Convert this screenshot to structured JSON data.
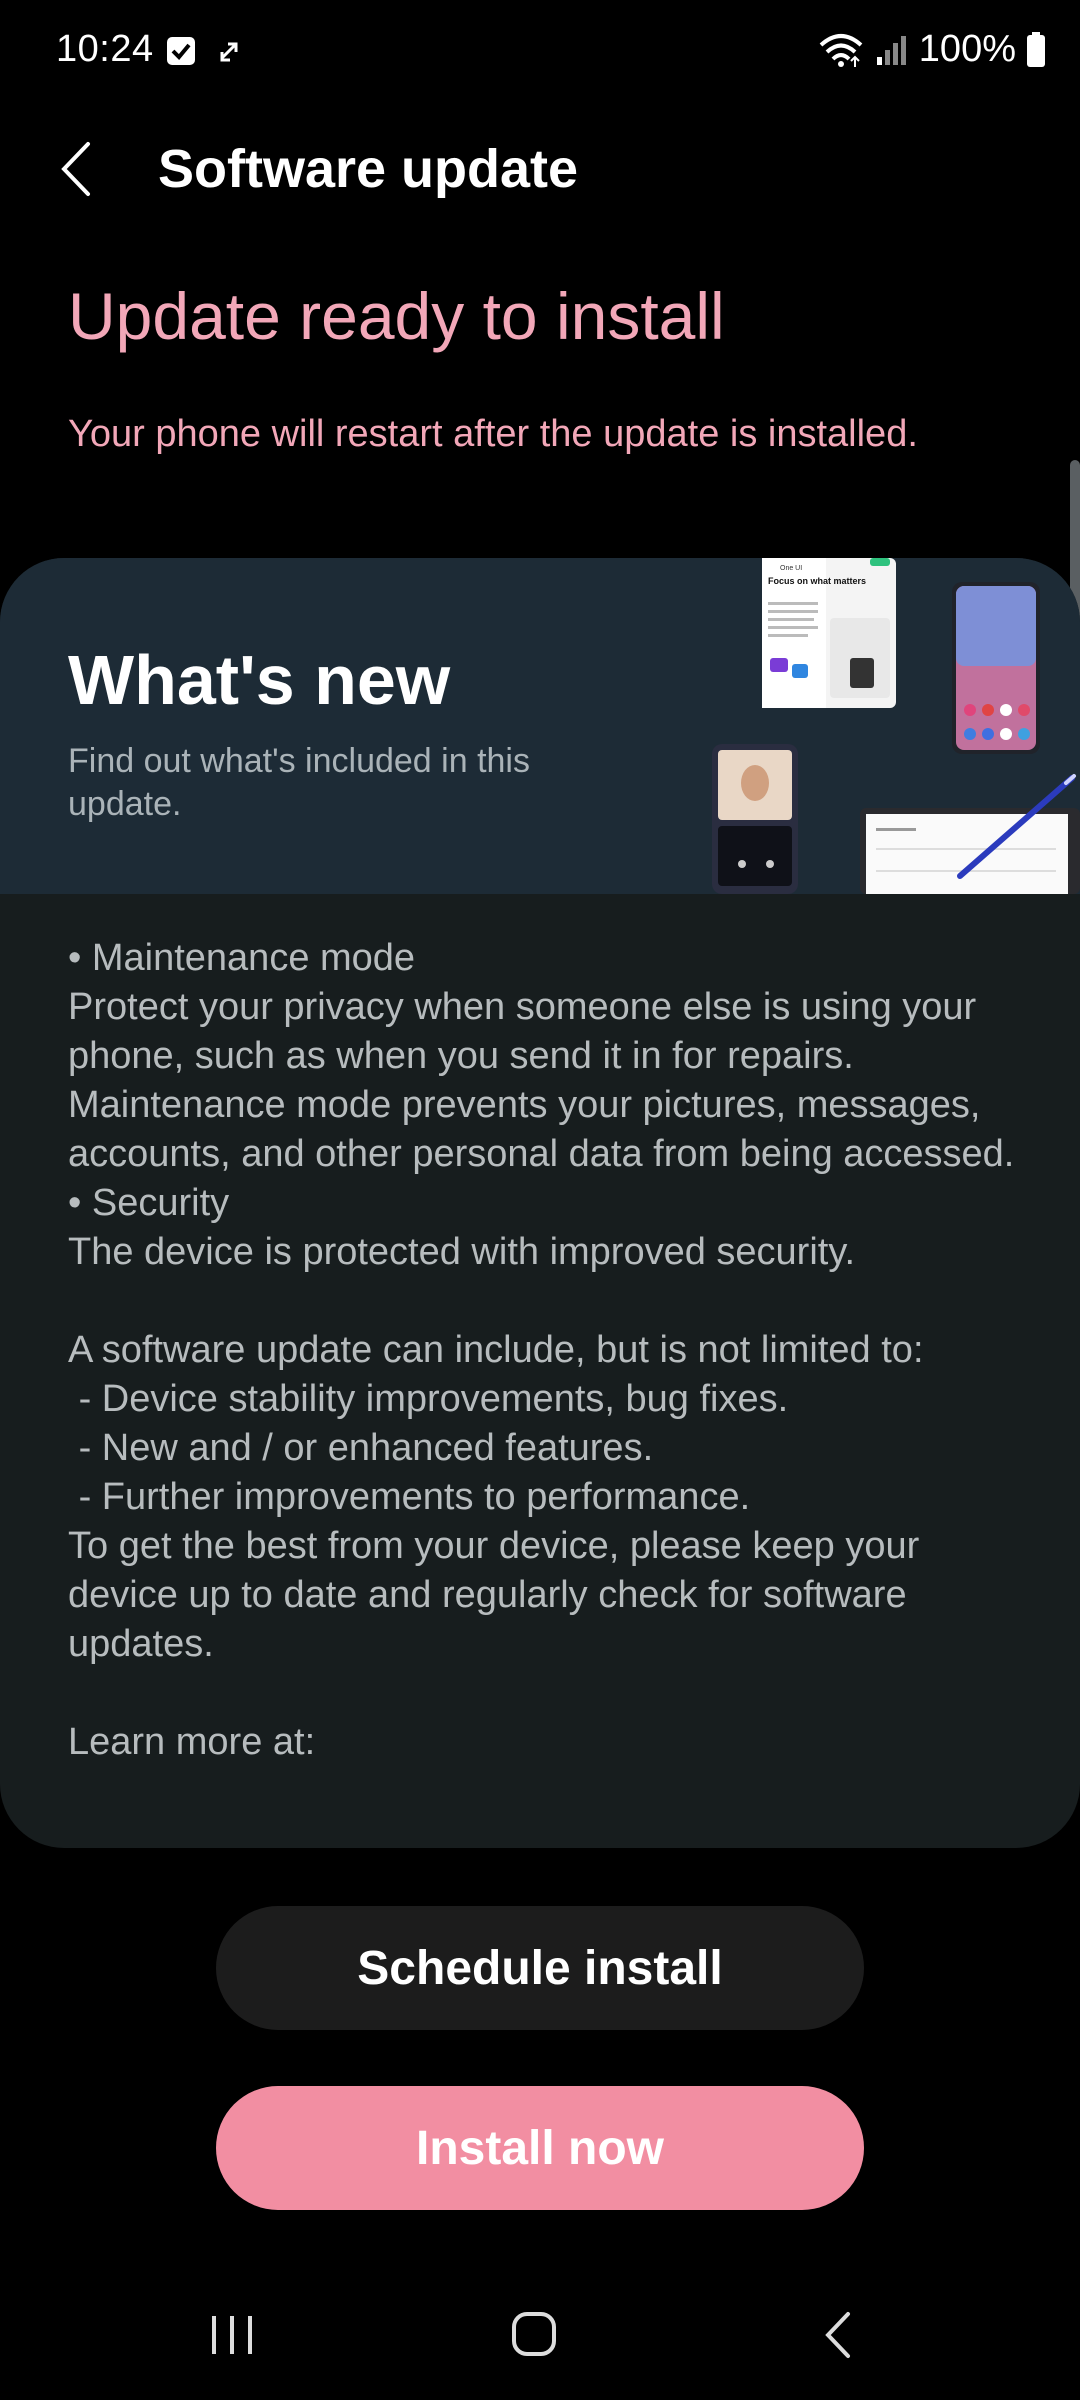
{
  "status_bar": {
    "time": "10:24",
    "battery": "100%"
  },
  "app_bar": {
    "title": "Software update"
  },
  "headline": "Update ready to install",
  "subheadline": "Your phone will restart after the update is installed.",
  "whats_new": {
    "title": "What's new",
    "subtitle": "Find out what's included in this update.",
    "notes": "• Maintenance mode\nProtect your privacy when someone else is using your phone, such as when you send it in for repairs. Maintenance mode prevents your pictures, messages, accounts, and other personal data from being accessed.\n• Security\nThe device is protected with improved security.\n\nA software update can include, but is not limited to:\n - Device stability improvements, bug fixes.\n - New and / or enhanced features.\n - Further improvements to performance.\nTo get the best from your device, please keep your device up to date and regularly check for software updates.\n\nLearn more at:",
    "illustration_text": {
      "tablet_heading_small": "One UI",
      "tablet_heading": "Focus on what matters"
    }
  },
  "buttons": {
    "schedule": "Schedule install",
    "install": "Install now"
  },
  "icons": {
    "back": "back-arrow-icon",
    "checkbox": "checkbox-notification-icon",
    "sync": "sync-arrows-icon",
    "wifi": "wifi-icon",
    "signal": "signal-icon",
    "battery": "battery-icon",
    "recents": "recents-icon",
    "home": "home-icon",
    "nav_back": "nav-back-icon"
  },
  "colors": {
    "accent": "#f2a7b8",
    "install_button": "#f28ea2",
    "card": "#171d1e",
    "banner": "#1d2b36"
  }
}
